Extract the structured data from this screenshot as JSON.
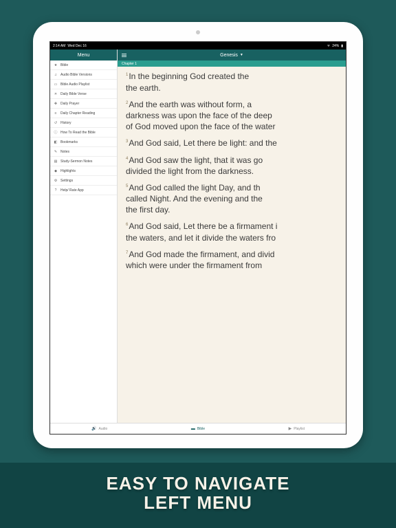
{
  "status": {
    "time": "2:14 AM",
    "date": "Wed Dec 16",
    "battery": "24%",
    "wifi": "wifi-icon"
  },
  "sidebar": {
    "title": "Menu",
    "items": [
      {
        "icon": "★",
        "icon_name": "star-icon",
        "label": "Bible"
      },
      {
        "icon": "♫",
        "icon_name": "music-icon",
        "label": "Audio Bible Versions"
      },
      {
        "icon": "▭",
        "icon_name": "playlist-icon",
        "label": "Bible Audio Playlist"
      },
      {
        "icon": "☀",
        "icon_name": "sun-icon",
        "label": "Daily Bible Verse"
      },
      {
        "icon": "✥",
        "icon_name": "pray-icon",
        "label": "Daily Prayer"
      },
      {
        "icon": "≡",
        "icon_name": "list-icon",
        "label": "Daily Chapter Reading"
      },
      {
        "icon": "↺",
        "icon_name": "history-icon",
        "label": "History"
      },
      {
        "icon": "ⓘ",
        "icon_name": "info-icon",
        "label": "How To Read the Bible"
      },
      {
        "icon": "◧",
        "icon_name": "bookmark-icon",
        "label": "Bookmarks"
      },
      {
        "icon": "✎",
        "icon_name": "pencil-icon",
        "label": "Notes"
      },
      {
        "icon": "▤",
        "icon_name": "notes-icon",
        "label": "Study-Sermon Notes"
      },
      {
        "icon": "◆",
        "icon_name": "highlight-icon",
        "label": "Highlights"
      },
      {
        "icon": "⚙",
        "icon_name": "gear-icon",
        "label": "Settings"
      },
      {
        "icon": "?",
        "icon_name": "help-icon",
        "label": "Help/ Rate App"
      }
    ]
  },
  "header": {
    "book": "Genesis",
    "chapter_label": "Chapter 1"
  },
  "verses": [
    {
      "n": "1",
      "l1": "In  the  beginning  God  created  the",
      "l2": "the earth."
    },
    {
      "n": "2",
      "l1": "And  the  earth  was  without  form,  a",
      "l2": "darkness was upon the face of the deep",
      "l3": "of God moved upon the face of the water"
    },
    {
      "n": "3",
      "l1": "And God said, Let there be light: and the"
    },
    {
      "n": "4",
      "l1": "And God saw the light, that it was go",
      "l2": "divided the light from the darkness."
    },
    {
      "n": "5",
      "l1": "And God called the light Day, and th",
      "l2": "called Night. And the evening and the",
      "l3": "the first day."
    },
    {
      "n": "6",
      "l1": "And God said, Let there be a firmament i",
      "l2": "the waters, and let it divide the waters fro"
    },
    {
      "n": "7",
      "l1": "And God made the firmament, and divid",
      "l2": "which  were  under  the  firmament  from"
    }
  ],
  "tabs": {
    "audio": "Audio",
    "bible": "Bible",
    "playlist": "Playlist"
  },
  "caption": {
    "line1": "EASY TO NAVIGATE",
    "line2": "LEFT MENU"
  }
}
